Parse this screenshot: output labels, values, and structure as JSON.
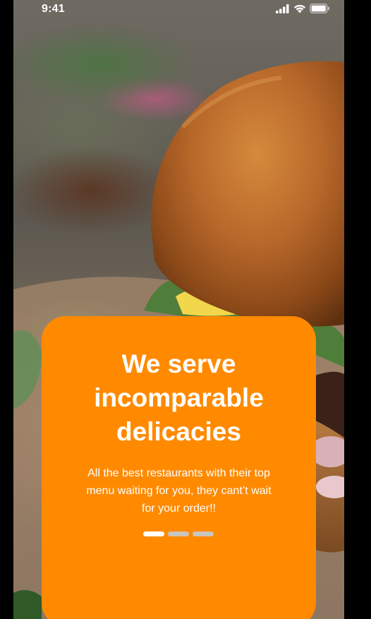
{
  "status_bar": {
    "time": "9:41",
    "icons": [
      "cellular-signal-icon",
      "wifi-icon",
      "battery-icon"
    ]
  },
  "onboarding": {
    "headline_lines": [
      "We serve",
      "incomparable",
      "delicacies"
    ],
    "subtitle_lines": [
      "All the best restaurants with their top",
      "menu waiting for you, they cant’t wait",
      "for your order!!"
    ],
    "pager": {
      "total": 3,
      "current": 1
    }
  },
  "colors": {
    "card": "#ff8a00",
    "text": "#ffffff",
    "dot_active": "#ffffff",
    "dot_inactive": "#c9c4bc"
  }
}
